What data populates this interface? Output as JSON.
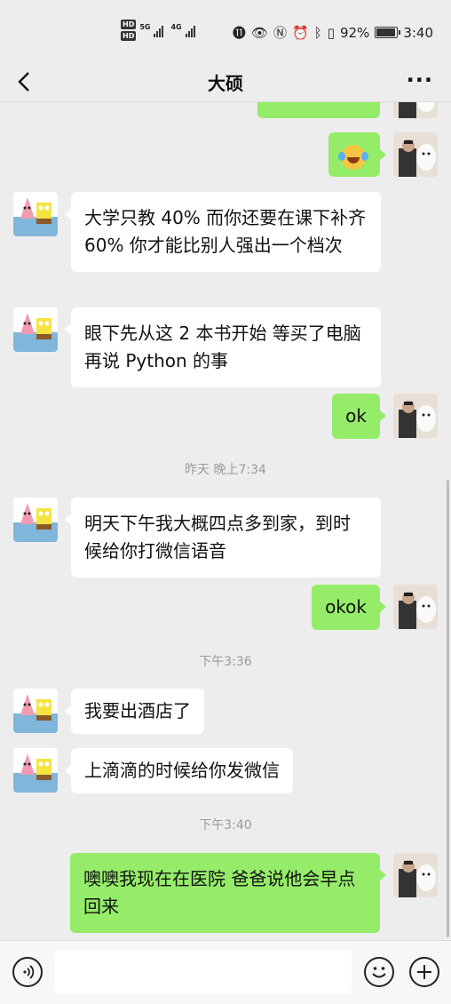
{
  "status_bar": {
    "hd1": "HD",
    "hd2": "HD",
    "net1": "5G",
    "net2": "4G",
    "battery_pct": "92%",
    "battery_level": 0.92,
    "time": "3:40"
  },
  "header": {
    "title": "大硕",
    "more": "···"
  },
  "messages": [
    {
      "from": "me",
      "text": ""
    },
    {
      "from": "me",
      "emoji": "laughing-crying-emoji"
    },
    {
      "from": "friend",
      "text": "大学只教 40% 而你还要在课下补齐 60% 你才能比别人强出一个档次"
    },
    {
      "from": "friend",
      "text": "眼下先从这 2 本书开始 等买了电脑再说 Python 的事"
    },
    {
      "from": "me",
      "text": "ok"
    },
    {
      "from": "time",
      "text": "昨天 晚上7:34"
    },
    {
      "from": "friend",
      "text": "明天下午我大概四点多到家，到时候给你打微信语音"
    },
    {
      "from": "me",
      "text": "okok"
    },
    {
      "from": "time",
      "text": "下午3:36"
    },
    {
      "from": "friend",
      "text": "我要出酒店了"
    },
    {
      "from": "friend",
      "text": "上滴滴的时候给你发微信"
    },
    {
      "from": "time",
      "text": "下午3:40"
    },
    {
      "from": "me",
      "text": "噢噢我现在在医院 爸爸说他会早点回来"
    }
  ],
  "input_bar": {
    "placeholder": ""
  },
  "colors": {
    "me_bubble": "#95ec69",
    "friend_bubble": "#ffffff",
    "background": "#ededed"
  }
}
